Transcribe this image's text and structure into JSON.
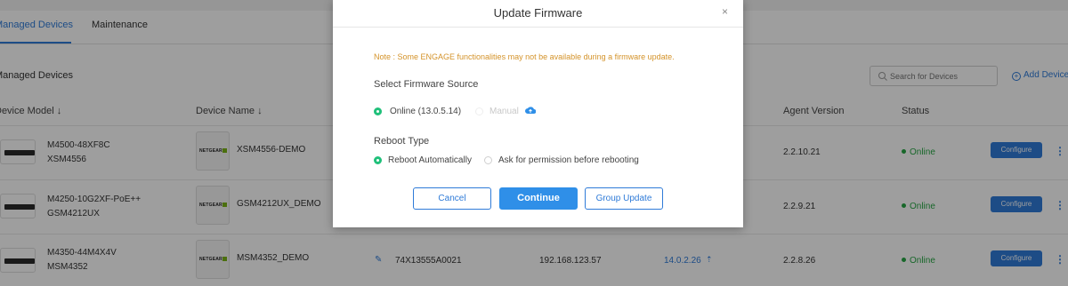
{
  "tabs": [
    {
      "label": "Managed Devices",
      "active": true
    },
    {
      "label": "Maintenance",
      "active": false
    }
  ],
  "section_title": "Managed Devices",
  "search": {
    "placeholder": "Search for Devices"
  },
  "add_device_label": "Add Device",
  "columns": {
    "device_model": "Device Model ↓",
    "device_name": "Device Name ↓",
    "agent_version": "Agent Version",
    "status": "Status"
  },
  "devices": [
    {
      "model": "M4500-48XF8C",
      "sku": "XSM4556",
      "name": "XSM4556-DEMO",
      "agent": "2.2.10.21",
      "status": "Online",
      "configure": "Configure"
    },
    {
      "model": "M4250-10G2XF-PoE++",
      "sku": "GSM4212UX",
      "name": "GSM4212UX_DEMO",
      "agent": "2.2.9.21",
      "status": "Online",
      "configure": "Configure"
    },
    {
      "model": "M4350-44M4X4V",
      "sku": "MSM4352",
      "name": "MSM4352_DEMO",
      "serial": "74X13555A0021",
      "ip": "192.168.123.57",
      "firmware": "14.0.2.26",
      "agent": "2.2.8.26",
      "status": "Online",
      "configure": "Configure"
    }
  ],
  "logo_text": "NETGEAR",
  "modal": {
    "title": "Update Firmware",
    "close": "×",
    "note": "Note : Some ENGAGE functionalities may not be available during a firmware update.",
    "source_label": "Select Firmware Source",
    "source_online": "Online (13.0.5.14)",
    "source_manual": "Manual",
    "reboot_label": "Reboot Type",
    "reboot_auto": "Reboot Automatically",
    "reboot_ask": "Ask for permission before rebooting",
    "buttons": {
      "cancel": "Cancel",
      "continue": "Continue",
      "group_update": "Group Update"
    }
  },
  "colors": {
    "accent": "#2f7bd8",
    "online": "#28a745",
    "note": "#d4932a",
    "radio_on": "#20c07a"
  }
}
